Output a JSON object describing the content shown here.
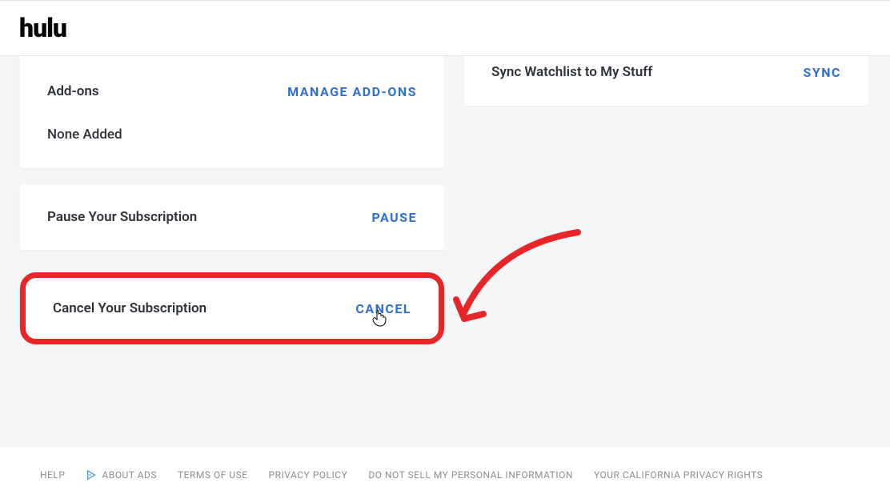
{
  "brand": {
    "logo": "hulu"
  },
  "addons": {
    "title": "Add-ons",
    "action": "MANAGE ADD-ONS",
    "value": "None Added"
  },
  "pause": {
    "title": "Pause Your Subscription",
    "action": "PAUSE"
  },
  "cancel": {
    "title": "Cancel Your Subscription",
    "action": "CANCEL"
  },
  "sync": {
    "title": "Sync Watchlist to My Stuff",
    "action": "SYNC"
  },
  "footer": {
    "help": "HELP",
    "about_ads": "ABOUT ADS",
    "terms": "TERMS OF USE",
    "privacy": "PRIVACY POLICY",
    "dns": "DO NOT SELL MY PERSONAL INFORMATION",
    "ccpa": "YOUR CALIFORNIA PRIVACY RIGHTS"
  }
}
